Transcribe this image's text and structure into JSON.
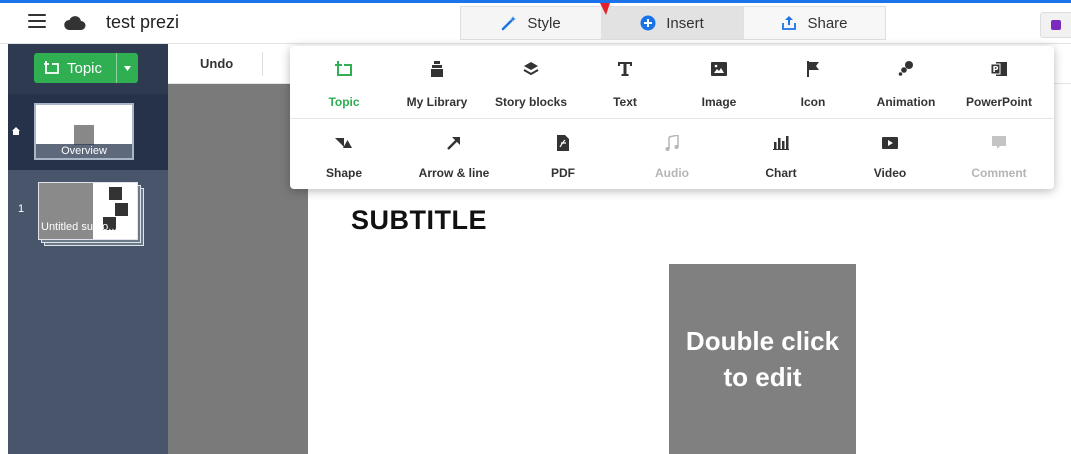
{
  "app": {
    "document_title": "test prezi"
  },
  "header": {
    "tabs": [
      {
        "label": "Style",
        "icon": "magic-wand-icon"
      },
      {
        "label": "Insert",
        "icon": "plus-circle-icon"
      },
      {
        "label": "Share",
        "icon": "share-upload-icon"
      }
    ]
  },
  "sidebar": {
    "topic_button": "Topic",
    "overview_label": "Overview",
    "slides": [
      {
        "number": "1",
        "label": "Untitled subto..."
      }
    ]
  },
  "toolbar": {
    "undo_label": "Undo"
  },
  "insert_menu": {
    "row1": [
      {
        "label": "Topic",
        "icon": "topic-icon",
        "state": "active"
      },
      {
        "label": "My Library",
        "icon": "library-icon",
        "state": "normal"
      },
      {
        "label": "Story blocks",
        "icon": "layers-icon",
        "state": "normal"
      },
      {
        "label": "Text",
        "icon": "text-icon",
        "state": "normal"
      },
      {
        "label": "Image",
        "icon": "image-icon",
        "state": "normal"
      },
      {
        "label": "Icon",
        "icon": "flag-icon",
        "state": "normal"
      },
      {
        "label": "Animation",
        "icon": "animation-icon",
        "state": "normal"
      },
      {
        "label": "PowerPoint",
        "icon": "powerpoint-icon",
        "state": "normal"
      }
    ],
    "row2": [
      {
        "label": "Shape",
        "icon": "shape-icon",
        "state": "normal"
      },
      {
        "label": "Arrow & line",
        "icon": "arrow-icon",
        "state": "normal"
      },
      {
        "label": "PDF",
        "icon": "pdf-icon",
        "state": "normal"
      },
      {
        "label": "Audio",
        "icon": "music-note-icon",
        "state": "disabled"
      },
      {
        "label": "Chart",
        "icon": "chart-icon",
        "state": "normal"
      },
      {
        "label": "Video",
        "icon": "video-icon",
        "state": "normal"
      },
      {
        "label": "Comment",
        "icon": "comment-icon",
        "state": "disabled"
      }
    ]
  },
  "canvas": {
    "subtitle": "SUBTITLE",
    "placeholder_text": "Double click to edit"
  },
  "colors": {
    "accent_green": "#2fae52",
    "rail_dark": "#2d3a50",
    "rail": "#48556a",
    "placeholder_gray": "#808080",
    "insert_icon_blue": "#1a73e8",
    "present_purple": "#7b2cbf"
  }
}
